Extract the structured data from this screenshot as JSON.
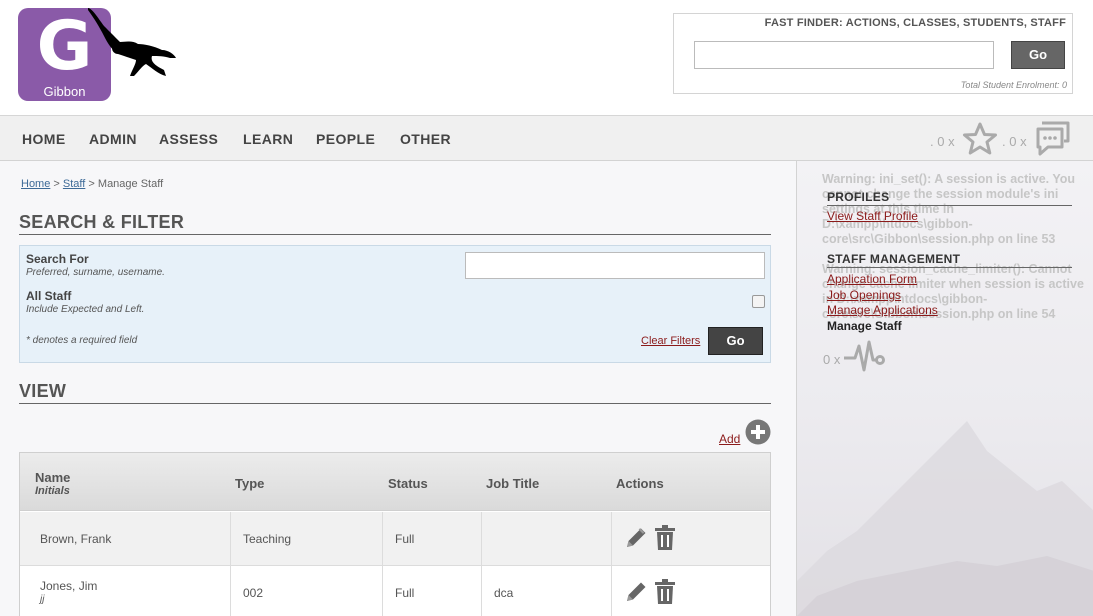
{
  "logo": {
    "letter": "G",
    "name": "Gibbon"
  },
  "fast_finder": {
    "title": "FAST FINDER: ACTIONS, CLASSES, STUDENTS, STAFF",
    "value": "",
    "go_label": "Go",
    "enrolment": "Total Student Enrolment: 0"
  },
  "nav": {
    "items": [
      "HOME",
      "ADMIN",
      "ASSESS",
      "LEARN",
      "PEOPLE",
      "OTHER"
    ],
    "likes_count": ". 0 x",
    "messages_count": ". 0 x"
  },
  "breadcrumb": {
    "home": "Home",
    "sep1": ">",
    "staff": "Staff",
    "sep2": ">",
    "current": "Manage Staff"
  },
  "search": {
    "title": "SEARCH & FILTER",
    "search_for_label": "Search For",
    "search_for_hint": "Preferred, surname, username.",
    "search_value": "",
    "all_staff_label": "All Staff",
    "all_staff_hint": "Include Expected and Left.",
    "required_note": "* denotes a required field",
    "clear_label": "Clear Filters",
    "go_label": "Go"
  },
  "view": {
    "title": "VIEW",
    "add_label": "Add",
    "columns": {
      "name": "Name",
      "initials": "Initials",
      "type": "Type",
      "status": "Status",
      "job_title": "Job Title",
      "actions": "Actions"
    },
    "rows": [
      {
        "name": "Brown, Frank",
        "initials": "",
        "type": "Teaching",
        "status": "Full",
        "job_title": ""
      },
      {
        "name": "Jones, Jim",
        "initials": "jj",
        "type": "002",
        "status": "Full",
        "job_title": "dca"
      }
    ]
  },
  "sidebar": {
    "warning1": "Warning: ini_set(): A session is active. You cannot change the session module's ini settings at this time in D:\\xampp\\htdocs\\gibbon-core\\src\\Gibbon\\session.php on line 53",
    "warning2": "Warning: session_cache_limiter(): Cannot change cache limiter when session is active in D:\\xampp\\htdocs\\gibbon-core\\src\\Gibbon\\session.php on line 54",
    "profiles_heading": "PROFILES",
    "view_staff_profile": "View Staff Profile",
    "staff_mgmt_heading": "STAFF MANAGEMENT",
    "application_form": "Application Form",
    "job_openings": "Job Openings",
    "manage_applications": "Manage Applications",
    "manage_staff": "Manage Staff",
    "alarm_count": "0 x"
  }
}
